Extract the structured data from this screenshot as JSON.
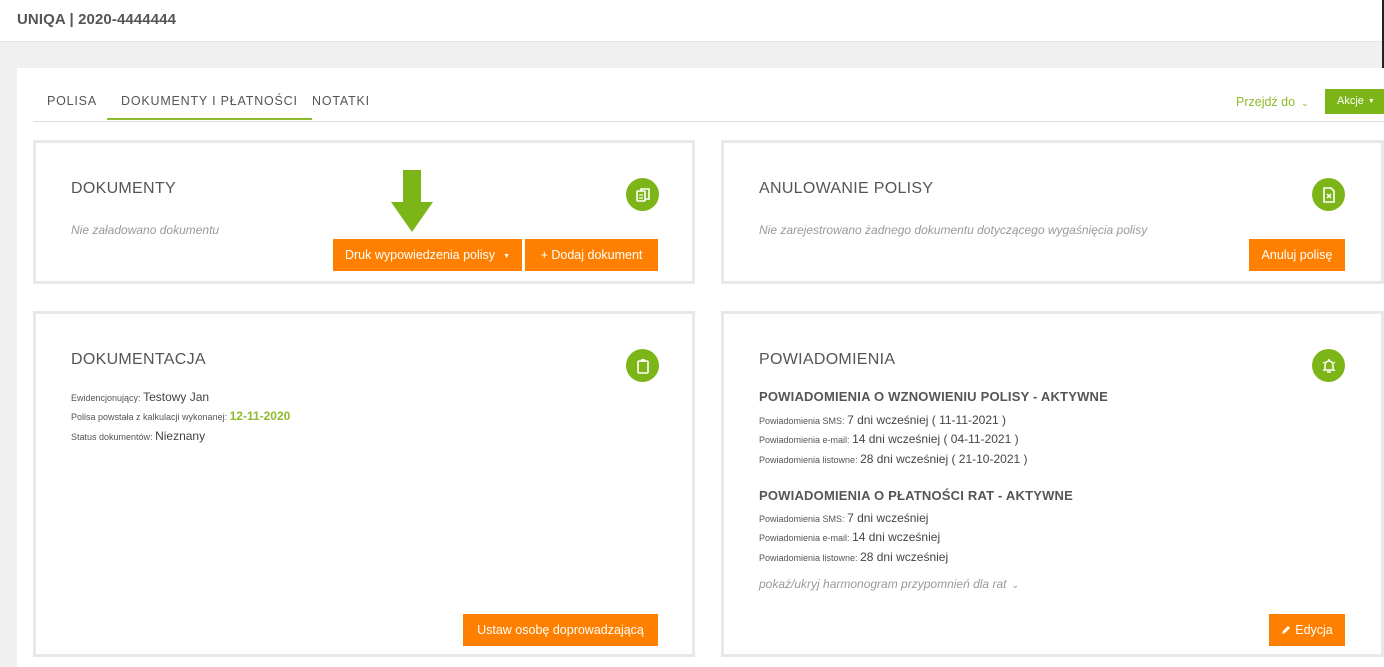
{
  "header": {
    "title": "UNIQA | 2020-4444444"
  },
  "tabs": [
    {
      "label": "POLISA"
    },
    {
      "label": "DOKUMENTY I PŁATNOŚCI"
    },
    {
      "label": "NOTATKI"
    }
  ],
  "toolbar": {
    "goto_label": "Przejdź do",
    "actions_label": "Akcje"
  },
  "documents": {
    "title": "DOKUMENTY",
    "empty_text": "Nie załadowano dokumentu",
    "print_button": "Druk wypowiedzenia polisy",
    "add_button": "+ Dodaj dokument"
  },
  "cancellation": {
    "title": "ANULOWANIE POLISY",
    "empty_text": "Nie zarejestrowano żadnego dokumentu dotyczącego wygaśnięcia polisy",
    "cancel_button": "Anuluj polisę"
  },
  "documentation": {
    "title": "DOKUMENTACJA",
    "registrar_label": "Ewidencjonujący:",
    "registrar_value": "Testowy Jan",
    "calc_label": "Polisa powstała z kalkulacji wykonanej:",
    "calc_value": "12-11-2020",
    "status_label": "Status dokumentów:",
    "status_value": "Nieznany",
    "assign_button": "Ustaw osobę doprowadzającą"
  },
  "notifications": {
    "title": "POWIADOMIENIA",
    "renewal": {
      "title": "POWIADOMIENIA O WZNOWIENIU POLISY - AKTYWNE",
      "sms_label": "Powiadomienia SMS:",
      "sms_value": "7 dni wcześniej ( 11-11-2021 )",
      "email_label": "Powiadomienia e-mail:",
      "email_value": "14 dni wcześniej ( 04-11-2021 )",
      "letter_label": "Powiadomienia listowne:",
      "letter_value": "28 dni wcześniej ( 21-10-2021 )"
    },
    "installments": {
      "title": "POWIADOMIENIA O PŁATNOŚCI RAT - AKTYWNE",
      "sms_label": "Powiadomienia SMS:",
      "sms_value": "7 dni wcześniej",
      "email_label": "Powiadomienia e-mail:",
      "email_value": "14 dni wcześniej",
      "letter_label": "Powiadomienia listowne:",
      "letter_value": "28 dni wcześniej"
    },
    "toggle_link": "pokaż/ukryj harmonogram przypomnień dla rat",
    "edit_button": "Edycja"
  },
  "colors": {
    "accent_green": "#7cb518",
    "orange": "#ff8000"
  },
  "icons": [
    "copy-icon",
    "file-x-icon",
    "clipboard-icon",
    "bell-icon",
    "pencil-icon",
    "chevron-down-icon",
    "caret-down-icon",
    "down-arrow-icon"
  ]
}
